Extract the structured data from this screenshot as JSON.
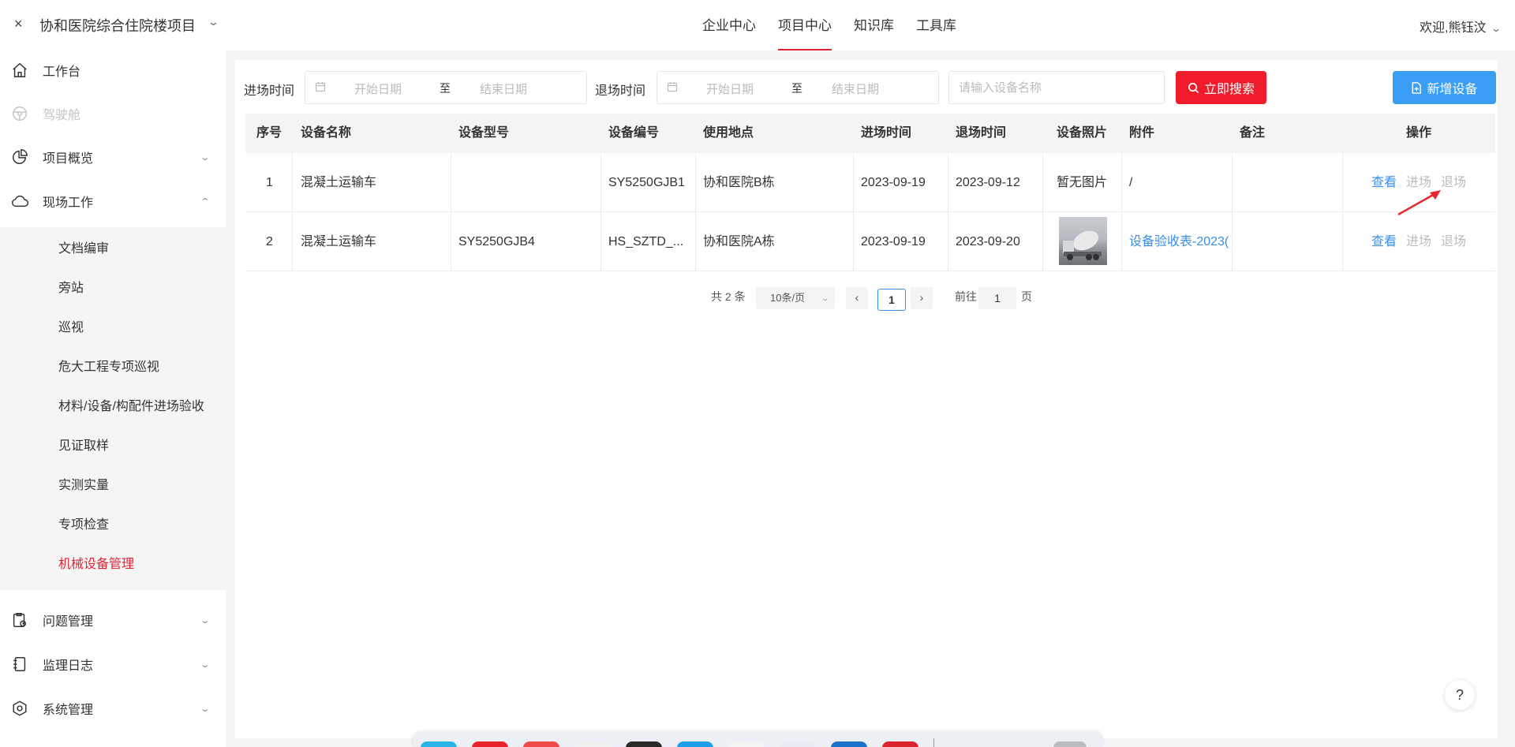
{
  "header": {
    "close_symbol": "×",
    "project_name": "协和医院综合住院楼项目",
    "nav": [
      "企业中心",
      "项目中心",
      "知识库",
      "工具库"
    ],
    "active_nav": "项目中心",
    "welcome": "欢迎,熊钰汶"
  },
  "sidebar": {
    "items": [
      {
        "label": "工作台",
        "icon": "home-icon"
      },
      {
        "label": "驾驶舱",
        "icon": "steering-wheel-icon",
        "disabled": true
      },
      {
        "label": "项目概览",
        "icon": "pie-chart-icon"
      },
      {
        "label": "现场工作",
        "icon": "cloud-icon",
        "expanded": true
      },
      {
        "label": "问题管理",
        "icon": "clipboard-icon"
      },
      {
        "label": "监理日志",
        "icon": "notebook-icon"
      },
      {
        "label": "系统管理",
        "icon": "hex-gear-icon"
      }
    ],
    "sub_items": [
      "文档编审",
      "旁站",
      "巡视",
      "危大工程专项巡视",
      "材料/设备/构配件进场验收",
      "见证取样",
      "实测实量",
      "专项检查",
      "机械设备管理"
    ],
    "active_sub": "机械设备管理"
  },
  "filters": {
    "entry_label": "进场时间",
    "exit_label": "退场时间",
    "start_placeholder": "开始日期",
    "end_placeholder": "结束日期",
    "range_sep": "至",
    "search_placeholder": "请输入设备名称",
    "search_button": "立即搜索",
    "add_button": "新增设备"
  },
  "table": {
    "columns": [
      "序号",
      "设备名称",
      "设备型号",
      "设备编号",
      "使用地点",
      "进场时间",
      "退场时间",
      "设备照片",
      "附件",
      "备注",
      "操作"
    ],
    "rows": [
      {
        "index": "1",
        "name": "混凝土运输车",
        "model": "",
        "code": "SY5250GJB1",
        "location": "协和医院B栋",
        "entry": "2023-09-19",
        "exit": "2023-09-12",
        "photo": "暂无图片",
        "attachment": "/",
        "remark": ""
      },
      {
        "index": "2",
        "name": "混凝土运输车",
        "model": "SY5250GJB4",
        "code": "HS_SZTD_...",
        "location": "协和医院A栋",
        "entry": "2023-09-19",
        "exit": "2023-09-20",
        "photo": "",
        "attachment": "设备验收表-2023(",
        "remark": ""
      }
    ],
    "actions": [
      "查看",
      "进场",
      "退场"
    ]
  },
  "pagination": {
    "total": "共 2 条",
    "page_size": "10条/页",
    "prev": "‹",
    "current": "1",
    "next": "›",
    "goto_label": "前往",
    "goto_value": "1",
    "page_label": "页"
  },
  "help": "?",
  "colors": {
    "accent_red": "#e02433",
    "button_red": "#f01c2c",
    "button_blue": "#3a9ef5",
    "link_blue": "#3a8ee6"
  }
}
